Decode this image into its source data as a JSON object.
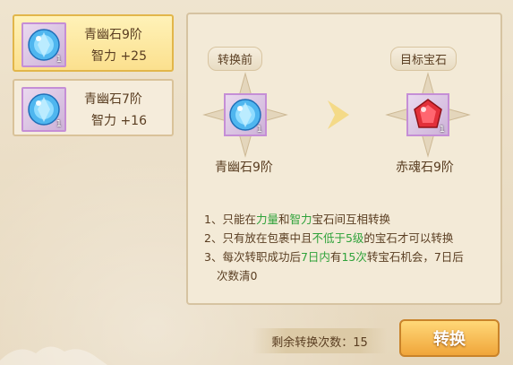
{
  "list": {
    "items": [
      {
        "name": "青幽石9阶",
        "attr": "智力 +25",
        "count": "1",
        "selected": true
      },
      {
        "name": "青幽石7阶",
        "attr": "智力 +16",
        "count": "1",
        "selected": false
      }
    ]
  },
  "panel": {
    "before_label": "转换前",
    "target_label": "目标宝石",
    "before_gem": {
      "name": "青幽石9阶",
      "count": "1"
    },
    "target_gem": {
      "name": "赤魂石9阶",
      "count": "1"
    }
  },
  "rules": {
    "r1": {
      "p1": "1、只能在",
      "h1": "力量",
      "p2": "和",
      "h2": "智力",
      "p3": "宝石间互相转换"
    },
    "r2": {
      "p1": "2、只有放在包裹中且",
      "h1": "不低于5级",
      "p2": "的宝石才可以转换"
    },
    "r3": {
      "p1": "3、每次转职成功后",
      "h1": "7日内",
      "p2": "有",
      "h2": "15次",
      "p3": "转宝石机会，7日后",
      "p4": "次数清0"
    }
  },
  "footer": {
    "remaining_text": "剩余转换次数：15",
    "convert_button": "转换"
  },
  "colors": {
    "highlight_green": "#2fa23a",
    "highlight_red": "#d23b2b",
    "selected_card": "#fbe08e",
    "button": "#f0a53a"
  },
  "icons": {
    "blue_gem": "blue-gem-icon",
    "red_gem": "red-gem-icon",
    "arrow": "arrow-right-icon"
  }
}
